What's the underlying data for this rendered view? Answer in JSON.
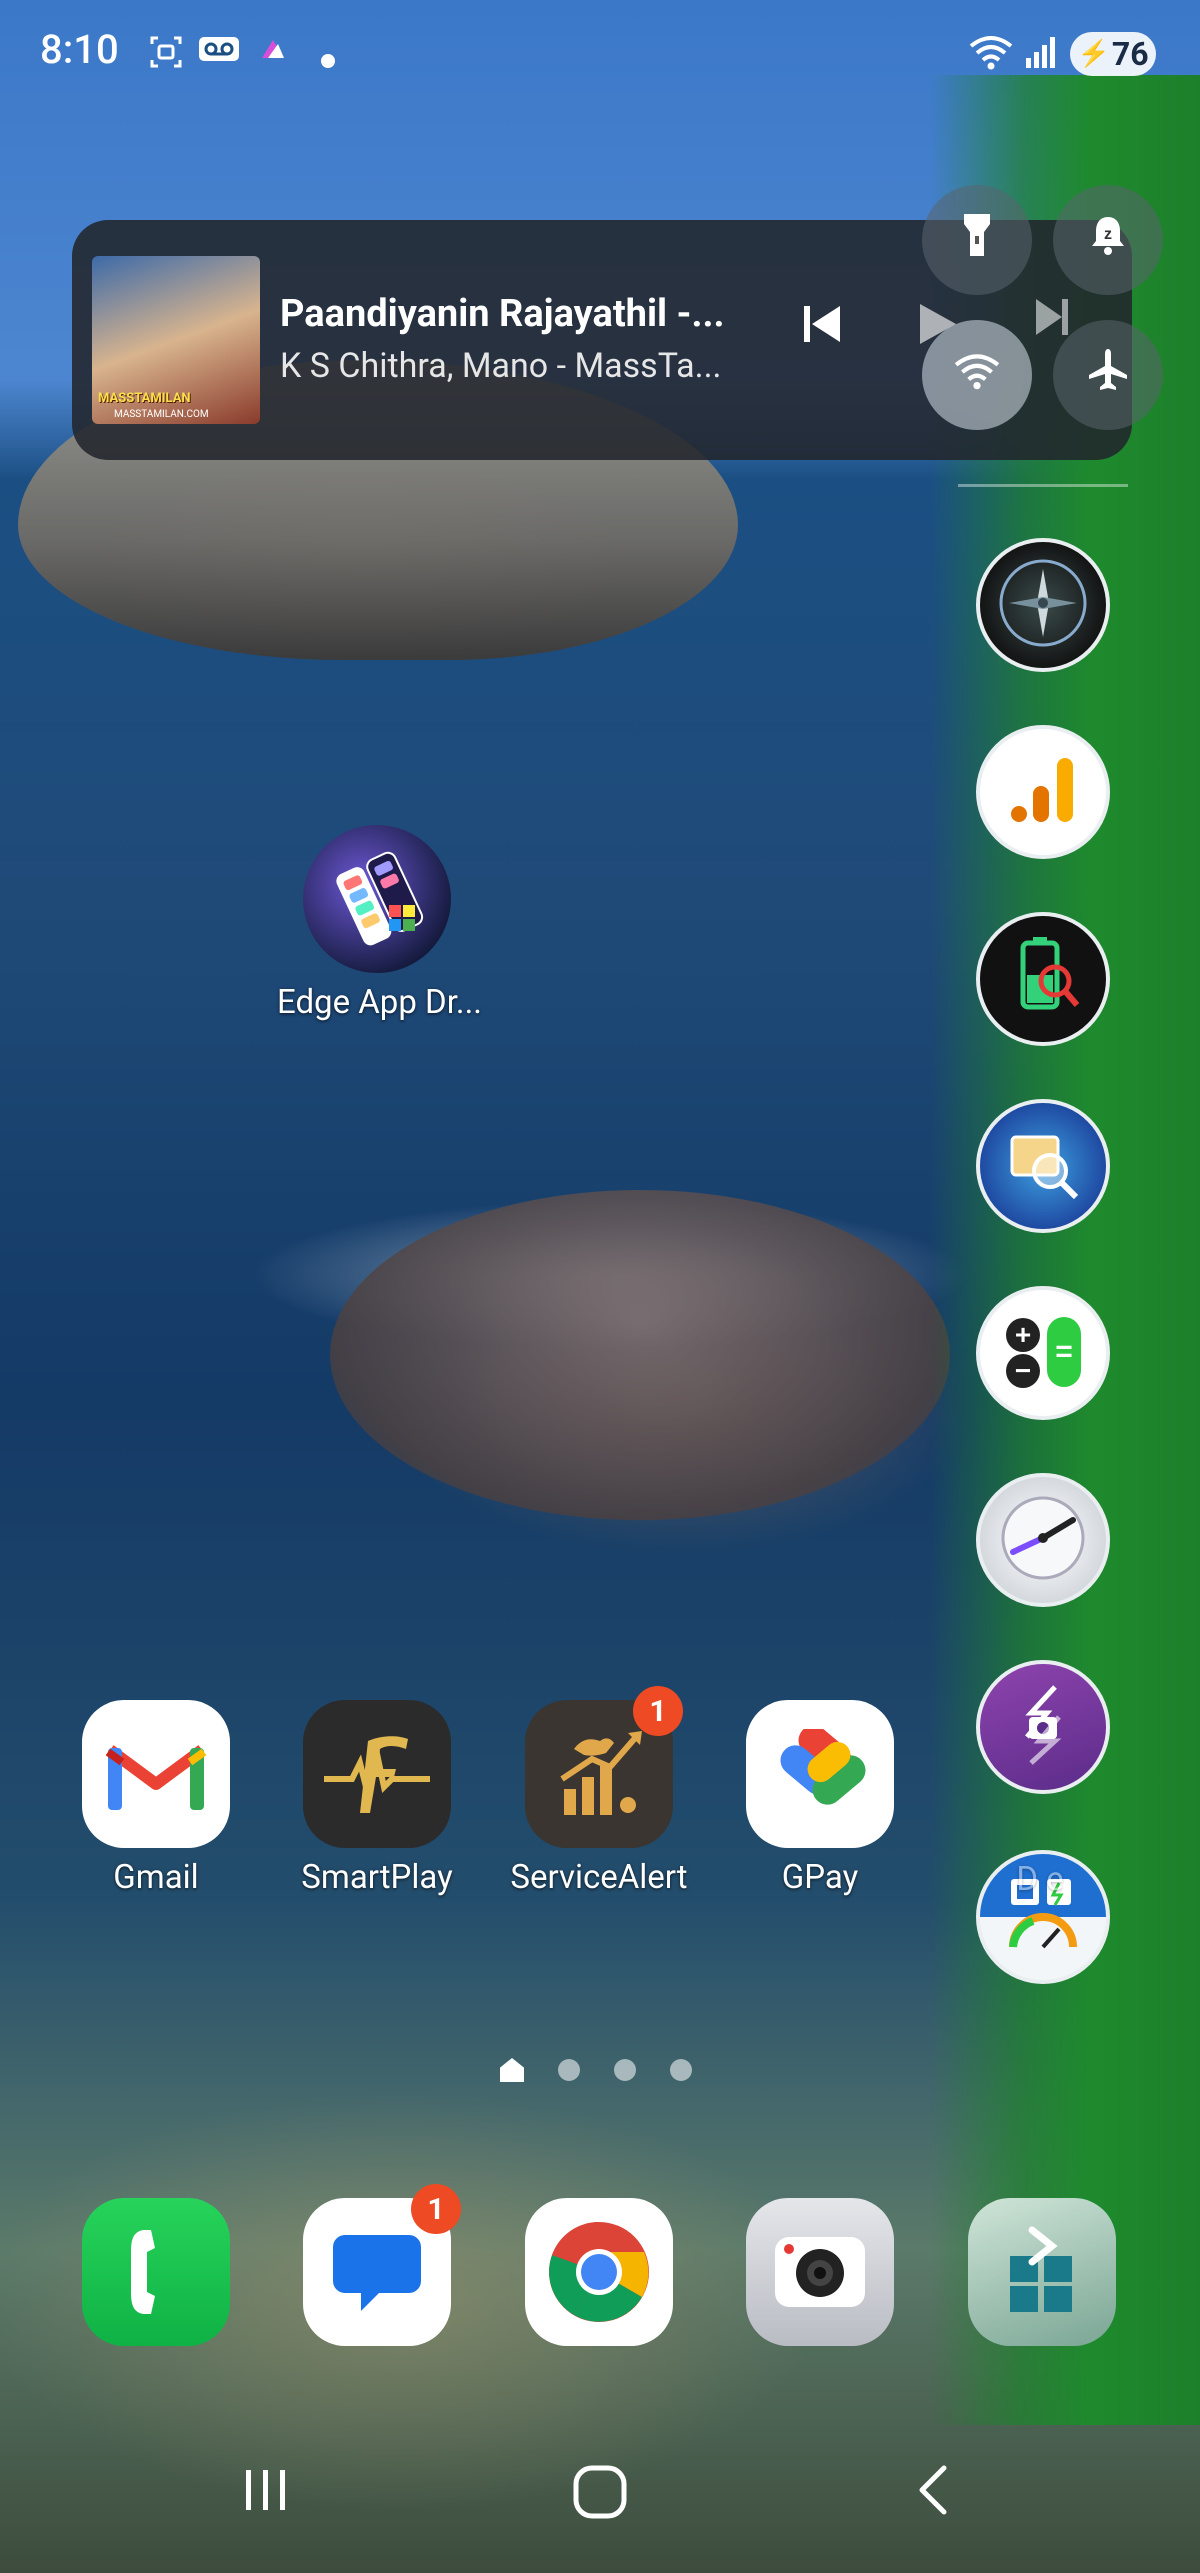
{
  "status_bar": {
    "time": "8:10",
    "battery": "76"
  },
  "media_player": {
    "album_caption": "MASSTAMILAN",
    "album_site": "MASSTAMILAN.COM",
    "title": "Paandiyanin Rajayathil -...",
    "artist": "K S Chithra, Mano - MassTa..."
  },
  "quick_settings": [
    {
      "name": "flashlight"
    },
    {
      "name": "sound-mode"
    },
    {
      "name": "wifi"
    },
    {
      "name": "airplane-mode"
    }
  ],
  "edge_panel_apps": [
    {
      "name": "compass"
    },
    {
      "name": "analytics"
    },
    {
      "name": "battery-checker"
    },
    {
      "name": "photo-search"
    },
    {
      "name": "calculator"
    },
    {
      "name": "speedometer"
    },
    {
      "name": "screen-rotate"
    },
    {
      "name": "device-info"
    }
  ],
  "edge_app_drawer": {
    "label": "Edge App Dr..."
  },
  "home_apps": [
    {
      "label": "Gmail"
    },
    {
      "label": "SmartPlay"
    },
    {
      "label": "ServiceAlert",
      "badge": "1"
    },
    {
      "label": "GPay"
    }
  ],
  "hidden_app_label": "D          e",
  "dock": [
    {
      "name": "phone"
    },
    {
      "name": "messages",
      "badge": "1"
    },
    {
      "name": "chrome"
    },
    {
      "name": "camera"
    },
    {
      "name": "app-manager"
    }
  ],
  "colors": {
    "edge_panel": "#1e8a2d",
    "badge": "#ee4a24"
  }
}
